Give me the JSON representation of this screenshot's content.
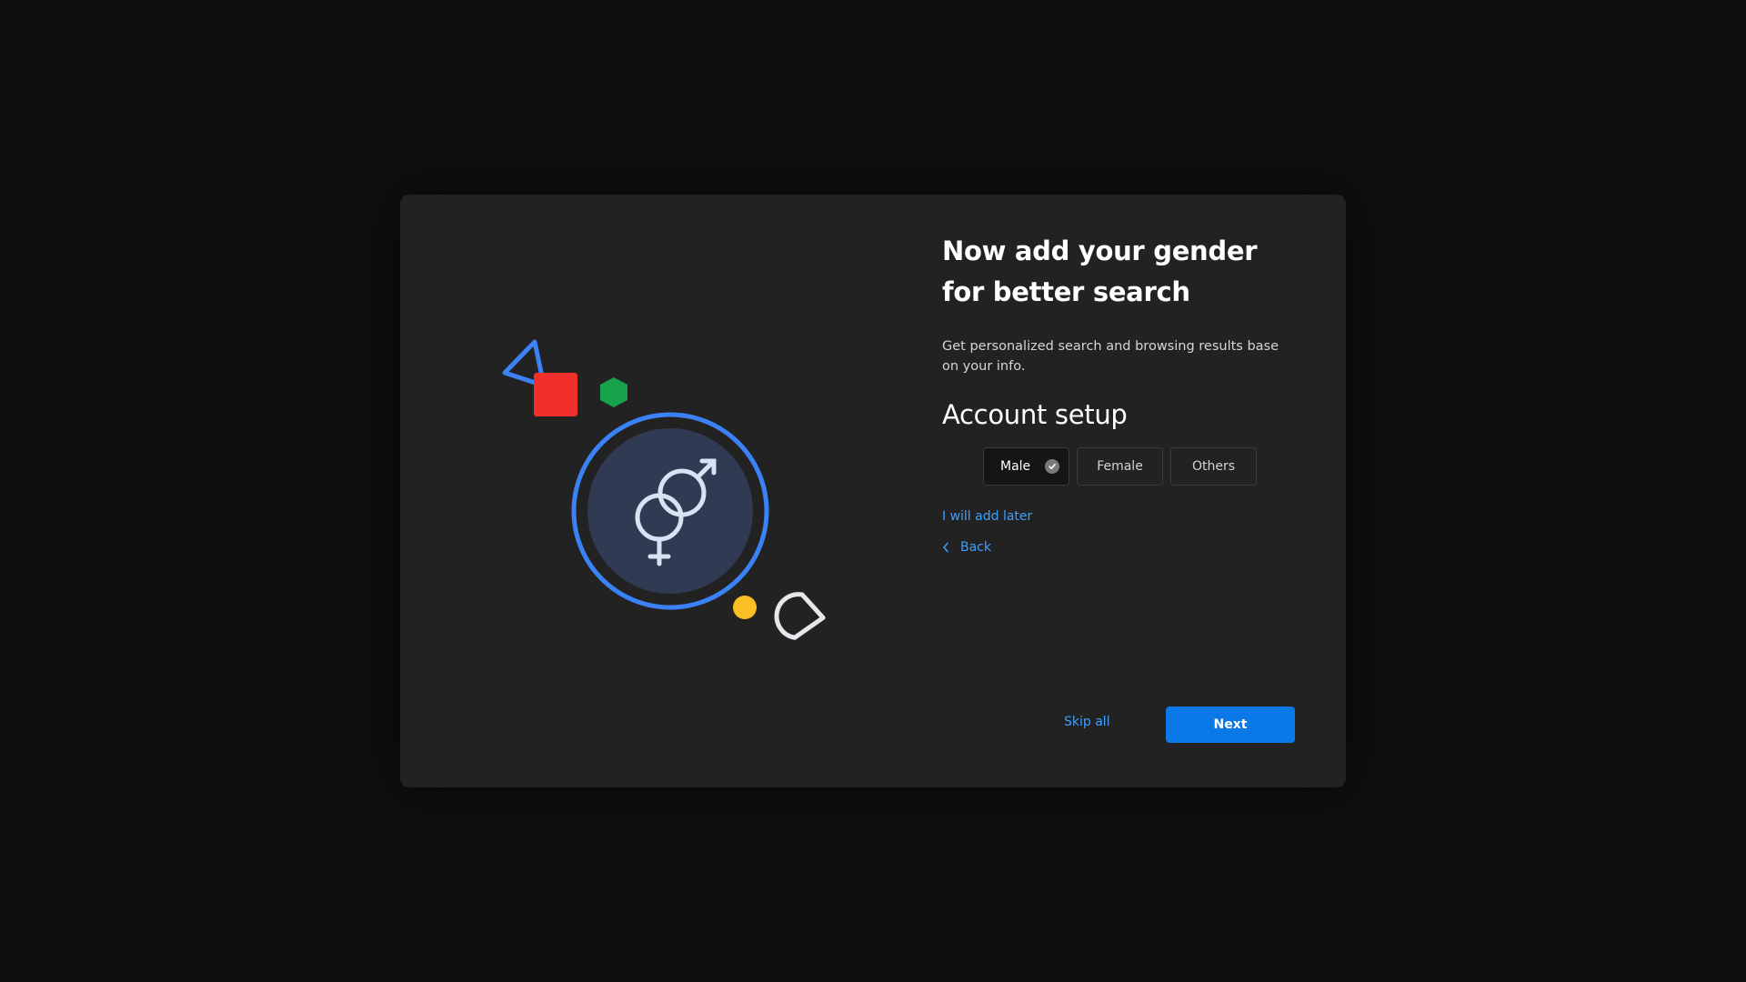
{
  "heading": {
    "title": "Now add your gender for better search",
    "subtitle": "Get personalized search and browsing results base on your info."
  },
  "section": {
    "title": "Account setup"
  },
  "gender_options": [
    {
      "label": "Male",
      "selected": true
    },
    {
      "label": "Female",
      "selected": false
    },
    {
      "label": "Others",
      "selected": false
    }
  ],
  "links": {
    "add_later": "I will add later",
    "back": "Back",
    "skip_all": "Skip all"
  },
  "buttons": {
    "next": "Next"
  },
  "colors": {
    "accent": "#0a78e6",
    "link": "#3da0ff",
    "background": "#0f0f0f",
    "panel": "#222222"
  },
  "icons": {
    "illustration_symbol": "gender-symbol-icon",
    "selected_check": "check-circle-icon",
    "back": "chevron-left-icon"
  }
}
